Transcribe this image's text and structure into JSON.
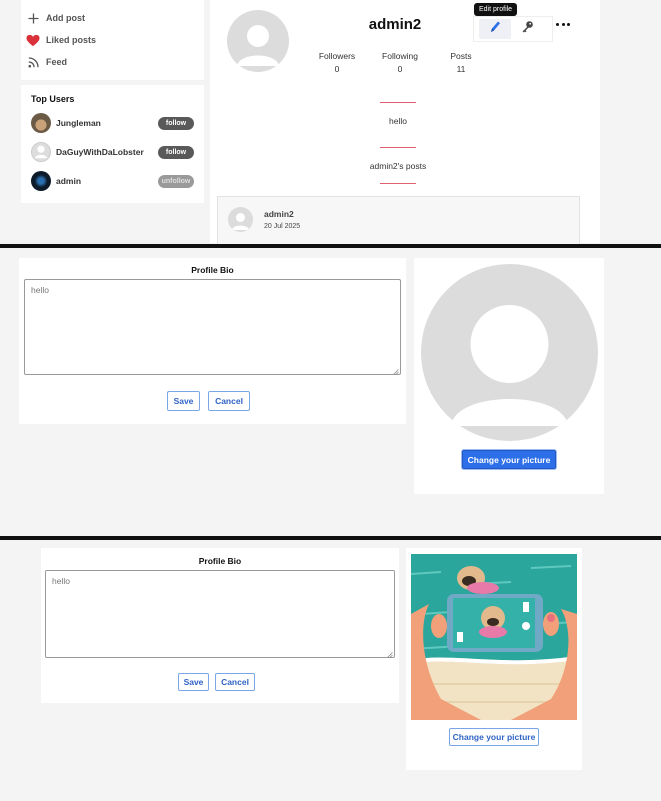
{
  "sidebar": {
    "items": [
      {
        "label": "Add post",
        "icon": "plus-icon"
      },
      {
        "label": "Liked posts",
        "icon": "heart-icon"
      },
      {
        "label": "Feed",
        "icon": "rss-icon"
      }
    ]
  },
  "top_users": {
    "title": "Top Users",
    "users": [
      {
        "name": "Jungleman",
        "action": "follow"
      },
      {
        "name": "DaGuyWithDaLobster",
        "action": "follow"
      },
      {
        "name": "admin",
        "action": "unfollow"
      }
    ]
  },
  "profile": {
    "username": "admin2",
    "tooltip": "Edit profile",
    "stats": [
      {
        "label": "Followers",
        "value": "0"
      },
      {
        "label": "Following",
        "value": "0"
      },
      {
        "label": "Posts",
        "value": "11"
      }
    ],
    "bio": "hello",
    "posts_heading": "admin2's posts",
    "post": {
      "author": "admin2",
      "date": "20 Jul 2025"
    }
  },
  "edit_form_1": {
    "title": "Profile Bio",
    "bio_value": "hello",
    "save_label": "Save",
    "cancel_label": "Cancel",
    "change_picture_label": "Change your picture"
  },
  "edit_form_2": {
    "title": "Profile Bio",
    "bio_value": "hello",
    "save_label": "Save",
    "cancel_label": "Cancel",
    "change_picture_label": "Change your picture"
  },
  "colors": {
    "accent": "#2c6fe8",
    "pink_divider": "#e06070",
    "follow_pill": "#595959",
    "unfollow_pill": "#9a9a9a"
  }
}
